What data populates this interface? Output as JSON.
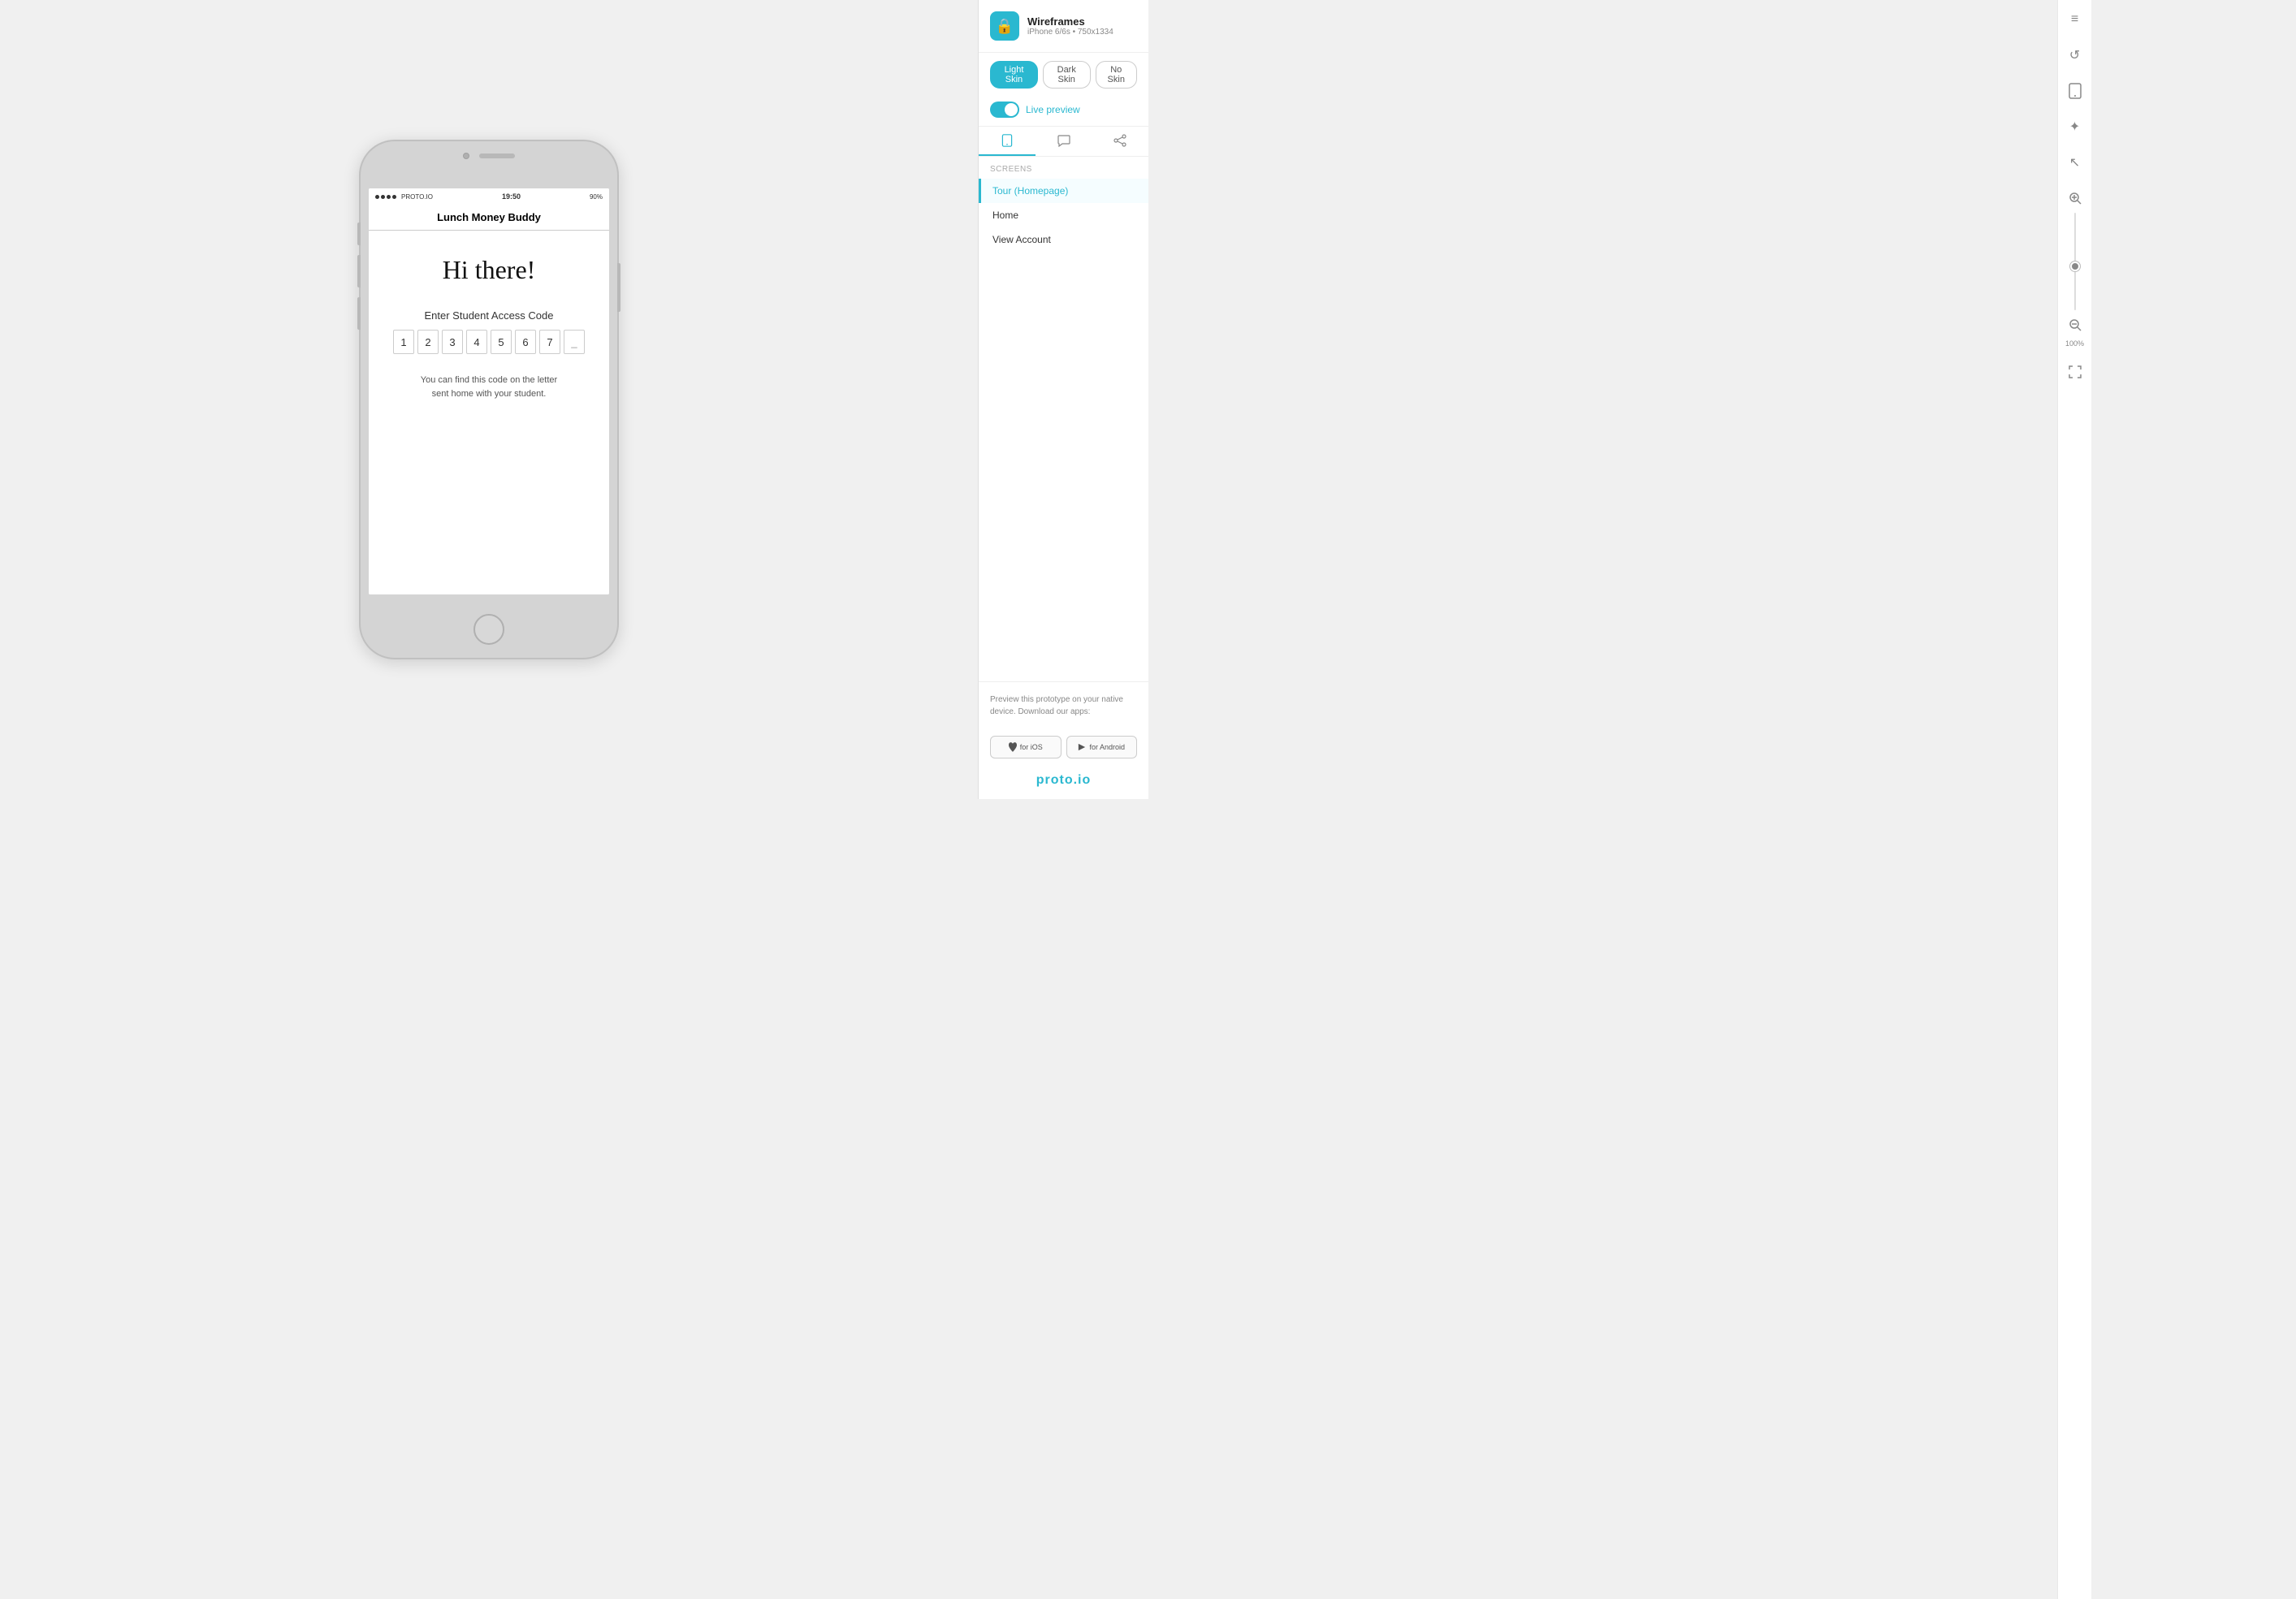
{
  "app": {
    "name": "Wireframes",
    "subtitle": "iPhone 6/6s • 750x1334",
    "icon_symbol": "🔒"
  },
  "skin_buttons": [
    {
      "label": "Light Skin",
      "active": true
    },
    {
      "label": "Dark Skin",
      "active": false
    },
    {
      "label": "No Skin",
      "active": false
    }
  ],
  "live_preview": {
    "label": "Live preview",
    "enabled": true
  },
  "screens_label": "SCREENS",
  "screens": [
    {
      "label": "Tour (Homepage)",
      "active": true
    },
    {
      "label": "Home",
      "active": false
    },
    {
      "label": "View Account",
      "active": false
    }
  ],
  "preview_section": {
    "text": "Preview this prototype on your native device. Download our apps:"
  },
  "app_store_buttons": [
    {
      "label": "for iOS"
    },
    {
      "label": "for Android"
    }
  ],
  "watermark": {
    "prefix": "proto",
    "suffix": ".io"
  },
  "phone": {
    "status_bar": {
      "carrier": "PROTO.IO",
      "time": "19:50",
      "battery": "90%"
    },
    "nav_title": "Lunch Money Buddy",
    "screen": {
      "greeting": "Hi there!",
      "access_code_label": "Enter Student Access Code",
      "code_digits": [
        "1",
        "2",
        "3",
        "4",
        "5",
        "6",
        "7",
        "_"
      ],
      "helper_text": "You can find this code on the letter sent home with your student."
    }
  },
  "zoom": {
    "percent": "100%"
  },
  "toolbar": {
    "menu_icon": "≡",
    "refresh_icon": "↺",
    "device_icon": "📱",
    "star_icon": "✦",
    "cursor_icon": "↖",
    "zoom_in_icon": "+",
    "zoom_out_icon": "−",
    "fullscreen_icon": "⛶"
  }
}
